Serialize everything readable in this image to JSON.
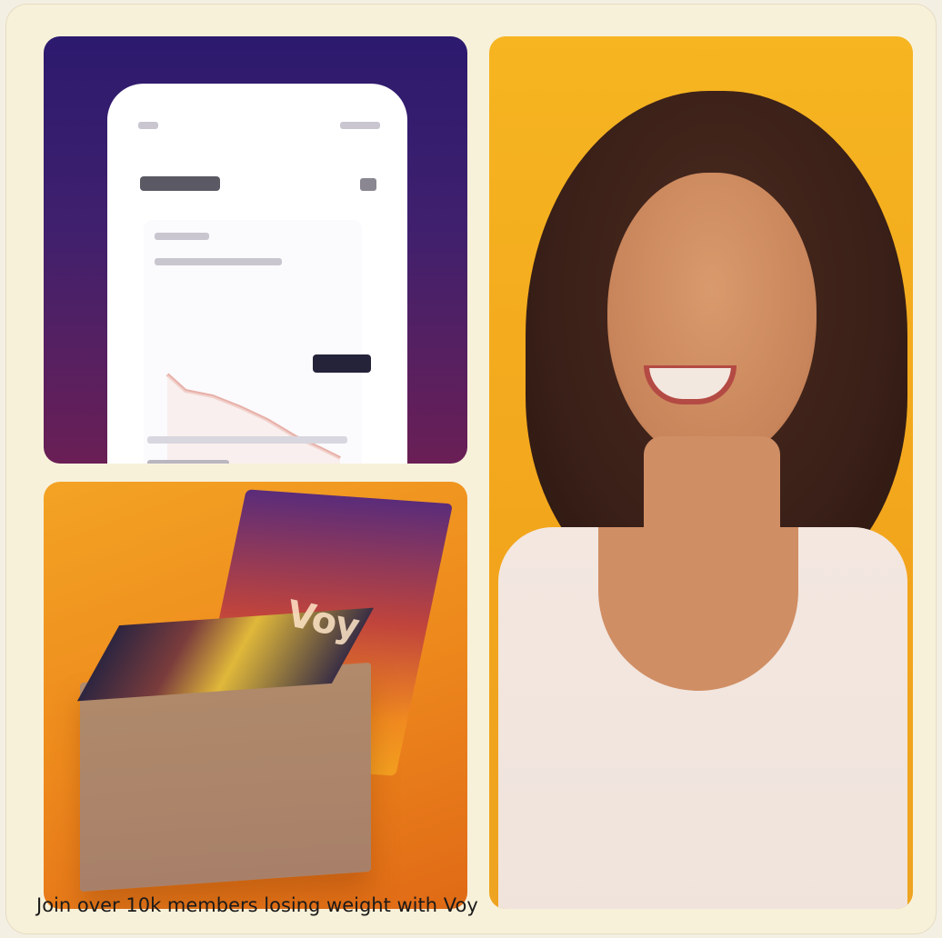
{
  "caption": "Join over 10k members losing weight with Voy",
  "brand_logo": "Voy",
  "colors": {
    "card_background": "#f8f1da",
    "purple_gradient_top": "#2c1a6e",
    "orange_tile": "#ee8a1d",
    "portrait_background": "#f2a51c"
  }
}
